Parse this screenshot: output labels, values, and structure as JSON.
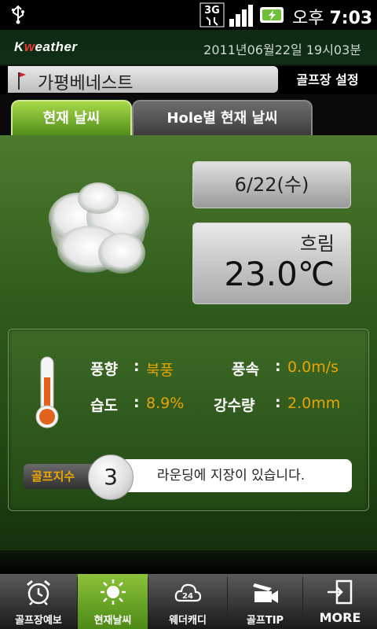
{
  "status": {
    "network": "3G",
    "ampm": "오후",
    "time": "7:03"
  },
  "app": {
    "logo_prefix": "K",
    "logo_accent": "w",
    "logo_suffix": "eather",
    "datetime": "2011년06월22일 19시03분"
  },
  "course": {
    "name": "가평베네스트",
    "setup_label": "골프장 설정"
  },
  "tabs": [
    {
      "label": "현재 날씨",
      "active": true
    },
    {
      "label": "Hole별 현재 날씨",
      "active": false
    }
  ],
  "weather": {
    "date": "6/22(수)",
    "condition": "흐림",
    "temperature": "23.0℃",
    "icon": "cloud-icon"
  },
  "details": {
    "wind_dir_label": "풍향",
    "wind_dir_value": "북풍",
    "wind_speed_label": "풍속",
    "wind_speed_value": "0.0m/s",
    "humidity_label": "습도",
    "humidity_value": "8.9%",
    "precip_label": "강수량",
    "precip_value": "2.0mm",
    "separator": ":"
  },
  "golf_index": {
    "label": "골프지수",
    "value": "3",
    "message": "라운딩에 지장이 있습니다."
  },
  "nav": [
    {
      "label": "골프장예보",
      "icon": "alarm-clock-icon",
      "active": false
    },
    {
      "label": "현재날씨",
      "icon": "sun-icon",
      "active": true
    },
    {
      "label": "웨더캐디",
      "icon": "cloud-24-icon",
      "active": false
    },
    {
      "label": "골프TIP",
      "icon": "video-camera-icon",
      "active": false
    },
    {
      "label": "MORE",
      "icon": "exit-door-icon",
      "active": false
    }
  ],
  "colors": {
    "accent_orange": "#e8a400",
    "tab_active": "#7ab82c",
    "logo_red": "#e73b2c"
  }
}
